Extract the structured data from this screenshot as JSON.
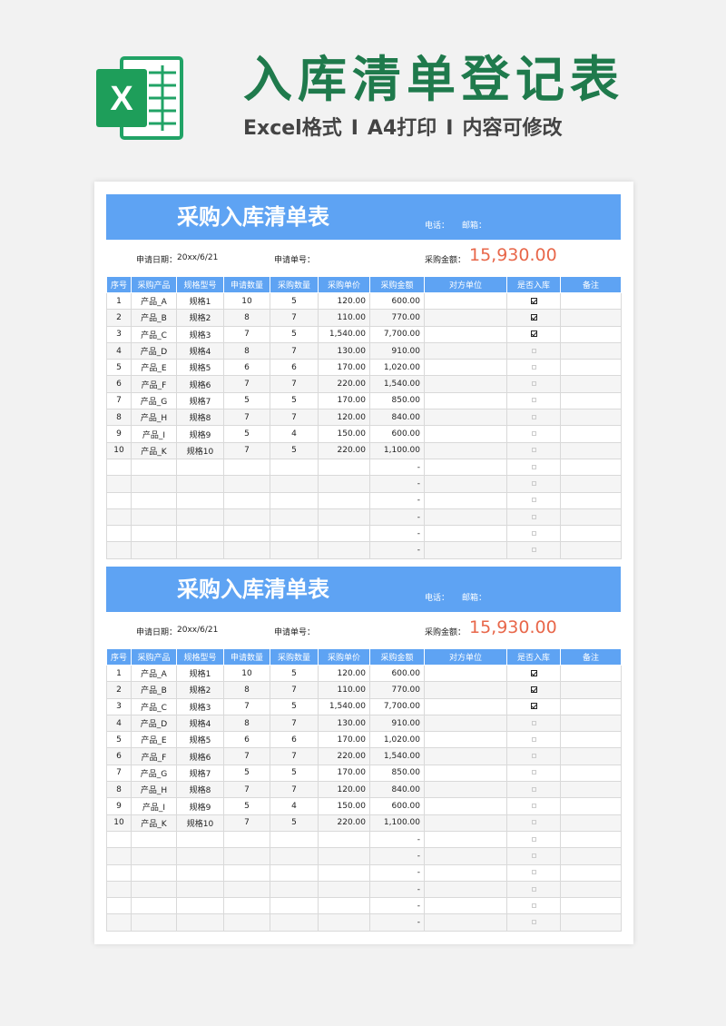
{
  "header": {
    "title": "入库清单登记表",
    "subtitle_parts": [
      "Excel格式",
      "A4打印",
      "内容可修改"
    ],
    "separator": "I"
  },
  "colors": {
    "brand_green": "#1f7a4c",
    "banner_blue": "#5ea3f3",
    "amount_red": "#e8674a"
  },
  "icons": {
    "logo": "excel-logo-icon",
    "checkbox_on": "checked-box-icon",
    "checkbox_off": "empty-box-icon"
  },
  "sheet": {
    "title": "采购入库清单表",
    "phone_label": "电话：",
    "email_label": "邮箱：",
    "apply_date_label": "申请日期：",
    "apply_date_value": "20xx/6/21",
    "order_no_label": "申请单号：",
    "amount_label": "采购金额：",
    "amount_value": "15,930.00",
    "columns": [
      "序号",
      "采购产品",
      "规格型号",
      "申请数量",
      "采购数量",
      "采购单价",
      "采购金额",
      "对方单位",
      "是否入库",
      "备注"
    ],
    "rows": [
      {
        "no": "1",
        "product": "产品_A",
        "spec": "规格1",
        "req": "10",
        "qty": "5",
        "price": "120.00",
        "amount": "600.00",
        "party": "",
        "in": true,
        "note": ""
      },
      {
        "no": "2",
        "product": "产品_B",
        "spec": "规格2",
        "req": "8",
        "qty": "7",
        "price": "110.00",
        "amount": "770.00",
        "party": "",
        "in": true,
        "note": ""
      },
      {
        "no": "3",
        "product": "产品_C",
        "spec": "规格3",
        "req": "7",
        "qty": "5",
        "price": "1,540.00",
        "amount": "7,700.00",
        "party": "",
        "in": true,
        "note": ""
      },
      {
        "no": "4",
        "product": "产品_D",
        "spec": "规格4",
        "req": "8",
        "qty": "7",
        "price": "130.00",
        "amount": "910.00",
        "party": "",
        "in": false,
        "note": ""
      },
      {
        "no": "5",
        "product": "产品_E",
        "spec": "规格5",
        "req": "6",
        "qty": "6",
        "price": "170.00",
        "amount": "1,020.00",
        "party": "",
        "in": false,
        "note": ""
      },
      {
        "no": "6",
        "product": "产品_F",
        "spec": "规格6",
        "req": "7",
        "qty": "7",
        "price": "220.00",
        "amount": "1,540.00",
        "party": "",
        "in": false,
        "note": ""
      },
      {
        "no": "7",
        "product": "产品_G",
        "spec": "规格7",
        "req": "5",
        "qty": "5",
        "price": "170.00",
        "amount": "850.00",
        "party": "",
        "in": false,
        "note": ""
      },
      {
        "no": "8",
        "product": "产品_H",
        "spec": "规格8",
        "req": "7",
        "qty": "7",
        "price": "120.00",
        "amount": "840.00",
        "party": "",
        "in": false,
        "note": ""
      },
      {
        "no": "9",
        "product": "产品_I",
        "spec": "规格9",
        "req": "5",
        "qty": "4",
        "price": "150.00",
        "amount": "600.00",
        "party": "",
        "in": false,
        "note": ""
      },
      {
        "no": "10",
        "product": "产品_K",
        "spec": "规格10",
        "req": "7",
        "qty": "5",
        "price": "220.00",
        "amount": "1,100.00",
        "party": "",
        "in": false,
        "note": ""
      },
      {
        "no": "",
        "product": "",
        "spec": "",
        "req": "",
        "qty": "",
        "price": "",
        "amount": "-",
        "party": "",
        "in": false,
        "note": ""
      },
      {
        "no": "",
        "product": "",
        "spec": "",
        "req": "",
        "qty": "",
        "price": "",
        "amount": "-",
        "party": "",
        "in": false,
        "note": ""
      },
      {
        "no": "",
        "product": "",
        "spec": "",
        "req": "",
        "qty": "",
        "price": "",
        "amount": "-",
        "party": "",
        "in": false,
        "note": ""
      },
      {
        "no": "",
        "product": "",
        "spec": "",
        "req": "",
        "qty": "",
        "price": "",
        "amount": "-",
        "party": "",
        "in": false,
        "note": ""
      },
      {
        "no": "",
        "product": "",
        "spec": "",
        "req": "",
        "qty": "",
        "price": "",
        "amount": "-",
        "party": "",
        "in": false,
        "note": ""
      },
      {
        "no": "",
        "product": "",
        "spec": "",
        "req": "",
        "qty": "",
        "price": "",
        "amount": "-",
        "party": "",
        "in": false,
        "note": ""
      }
    ]
  }
}
